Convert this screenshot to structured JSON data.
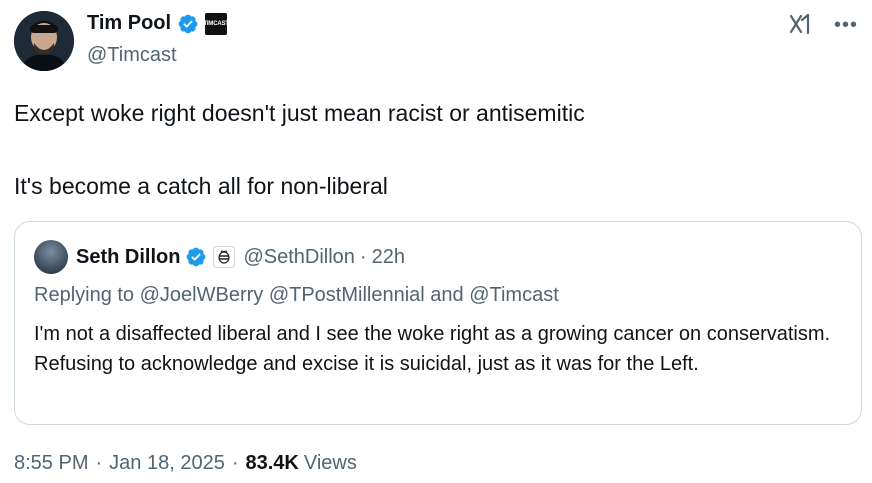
{
  "author": {
    "display_name": "Tim Pool",
    "handle": "@Timcast",
    "affiliate_badge_text": "TIMCAST",
    "verified_icon": "verified-badge-icon",
    "avatar_icon": "avatar"
  },
  "top_actions": {
    "grok_icon": "grok-icon",
    "more_icon": "more-options-icon"
  },
  "tweet": {
    "paragraphs": [
      "Except woke right doesn't just mean racist or antisemitic",
      "It's become a catch all for non-liberal"
    ]
  },
  "quote": {
    "display_name": "Seth Dillon",
    "handle": "@SethDillon",
    "separator": "·",
    "time": "22h",
    "replying_to": "Replying to @JoelWBerry @TPostMillennial and @Timcast",
    "text": "I'm not a disaffected liberal and I see the woke right as a growing cancer on conservatism. Refusing to acknowledge and excise it is suicidal, just as it was for the Left."
  },
  "meta": {
    "time": "8:55 PM",
    "date": "Jan 18, 2025",
    "separator": "·",
    "views_count": "83.4K",
    "views_label": "Views"
  },
  "colors": {
    "verified_blue": "#1d9bf0",
    "text_primary": "#0f1419",
    "text_secondary": "#536471",
    "border": "#cfd9de"
  }
}
